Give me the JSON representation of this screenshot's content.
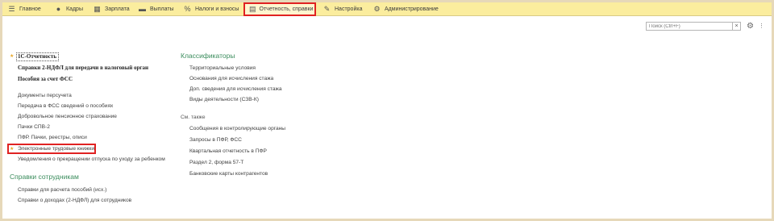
{
  "nav": {
    "tabs": [
      {
        "label": "Главное",
        "icon": "hamburger-icon",
        "glyph": "☰"
      },
      {
        "label": "Кадры",
        "icon": "people-icon",
        "glyph": "👥"
      },
      {
        "label": "Зарплата",
        "icon": "calculator-icon",
        "glyph": "▦"
      },
      {
        "label": "Выплаты",
        "icon": "wallet-icon",
        "glyph": "▬"
      },
      {
        "label": "Налоги и взносы",
        "icon": "percent-icon",
        "glyph": "%"
      },
      {
        "label": "Отчетность, справки",
        "icon": "reports-icon",
        "glyph": "🗐"
      },
      {
        "label": "Настройка",
        "icon": "wrench-icon",
        "glyph": "🔧"
      },
      {
        "label": "Администрирование",
        "icon": "gear-icon",
        "glyph": "⚙"
      }
    ]
  },
  "search": {
    "placeholder": "Поиск (Ctrl+F)",
    "clear": "×"
  },
  "toolbar": {
    "settings_glyph": "⚙",
    "more_glyph": "⋮"
  },
  "left": {
    "top_links": [
      "1С-Отчетность",
      "Справки 2-НДФЛ для передачи в налоговый орган",
      "Пособия за счет ФСС"
    ],
    "links": [
      "Документы персучета",
      "Передача в ФСС сведений о пособиях",
      "Добровольное пенсионное страхование",
      "Пачки СПВ-2",
      "ПФР. Пачки, реестры, описи",
      "Электронные трудовые книжки",
      "Уведомления о прекращении отпуска по уходу за ребенком"
    ],
    "section2_title": "Справки сотрудникам",
    "section2_links": [
      "Справки для расчета пособий (исх.)",
      "Справки о доходах (2-НДФЛ) для сотрудников"
    ]
  },
  "right": {
    "section1_title": "Классификаторы",
    "section1_links": [
      "Территориальные условия",
      "Основания для исчисления стажа",
      "Доп. сведения для исчисления стажа",
      "Виды деятельности (СЗВ-К)"
    ],
    "section2_title": "См. также",
    "section2_links": [
      "Сообщения в контролирующие органы",
      "Запросы в ПФР, ФСС",
      "Квартальная отчетность в ПФР",
      "Раздел 2, форма 57-Т",
      "Банковские карты контрагентов"
    ]
  },
  "colors": {
    "accent_green": "#3a8c5c",
    "highlight_red": "#e02222",
    "topbar": "#fbed9e",
    "star": "#e8a82c"
  }
}
